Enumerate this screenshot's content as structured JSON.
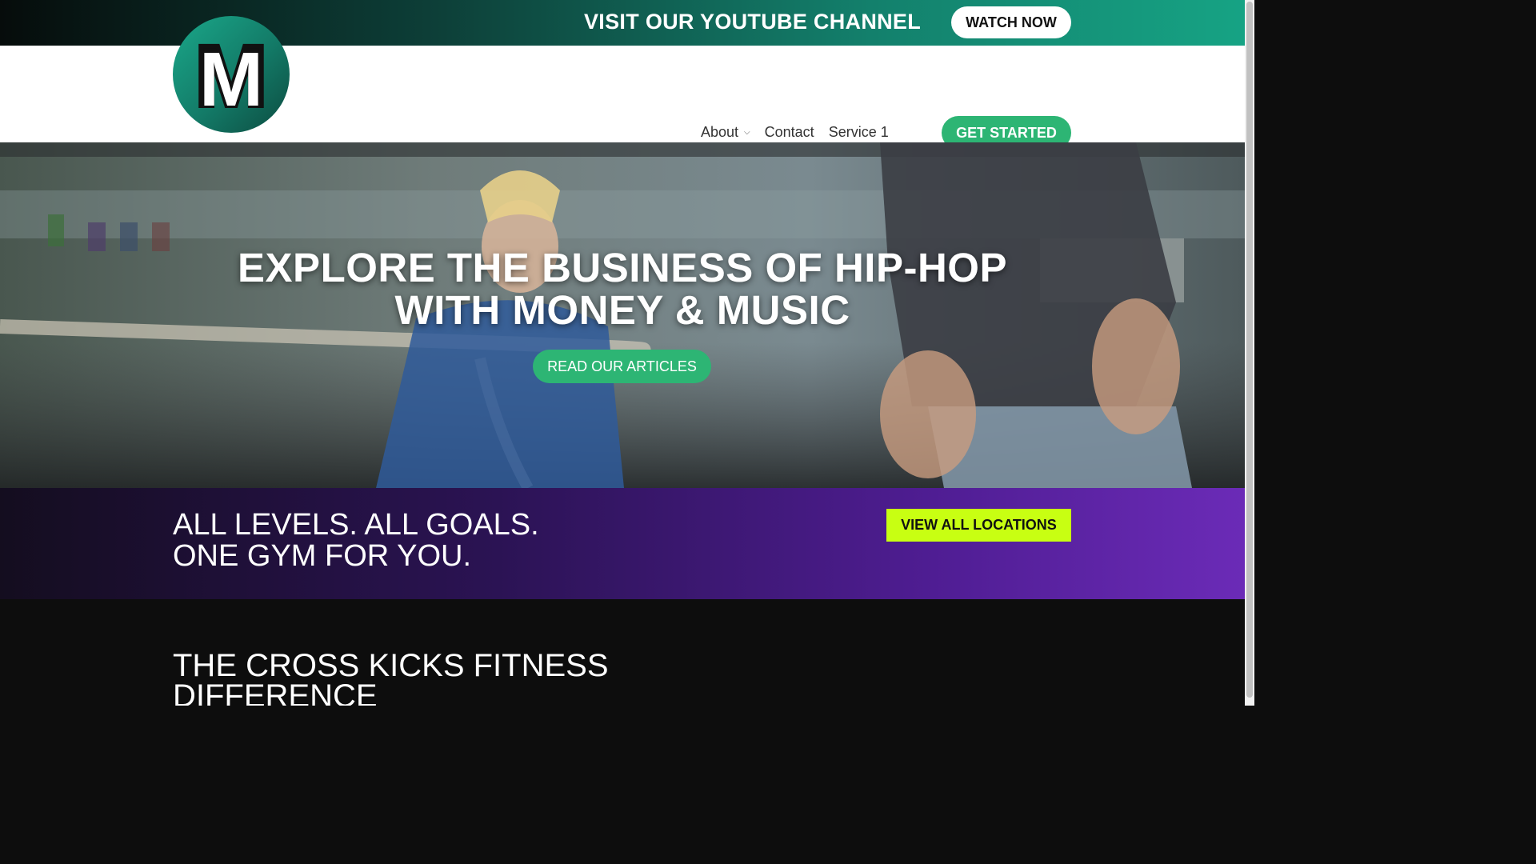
{
  "topbar": {
    "promo_text": "VISIT OUR YOUTUBE CHANNEL",
    "watch_label": "WATCH NOW"
  },
  "header": {
    "logo_letter": "M",
    "nav": [
      {
        "label": "About",
        "has_dropdown": true
      },
      {
        "label": "Contact"
      },
      {
        "label": "Service 1"
      }
    ],
    "cta_label": "GET STARTED"
  },
  "hero": {
    "title": "EXPLORE THE BUSINESS OF HIP-HOP WITH MONEY & MUSIC",
    "button_label": "READ OUR ARTICLES"
  },
  "levels": {
    "line1": "ALL LEVELS. ALL GOALS.",
    "line2": "ONE GYM FOR YOU.",
    "button_label": "VIEW ALL LOCATIONS"
  },
  "difference": {
    "title": "THE CROSS KICKS FITNESS DIFFERENCE"
  },
  "colors": {
    "accent_green": "#2db574",
    "lime": "#c8ff12",
    "purple": "#4f1d93",
    "teal": "#13806c"
  },
  "icons": {
    "dropdown": "chevron-down-icon"
  }
}
